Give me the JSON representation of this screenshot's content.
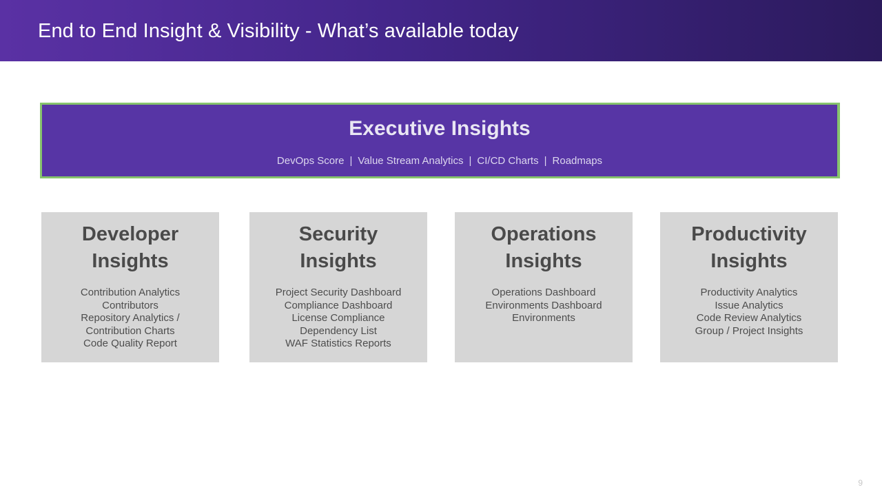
{
  "header": {
    "title": "End to End Insight & Visibility - What’s available today"
  },
  "executive": {
    "title": "Executive Insights",
    "items": [
      "DevOps Score",
      "Value Stream Analytics",
      "CI/CD Charts",
      "Roadmaps"
    ],
    "separator": "|"
  },
  "cards": [
    {
      "title_line1": "Developer",
      "title_line2": "Insights",
      "items": [
        "Contribution Analytics",
        "Contributors",
        "Repository Analytics /",
        "Contribution Charts",
        "Code Quality Report"
      ]
    },
    {
      "title_line1": "Security",
      "title_line2": "Insights",
      "items": [
        "Project Security Dashboard",
        "Compliance Dashboard",
        "License Compliance",
        "Dependency List",
        "WAF Statistics Reports"
      ]
    },
    {
      "title_line1": "Operations",
      "title_line2": "Insights",
      "items": [
        "Operations Dashboard",
        "Environments Dashboard",
        "Environments"
      ]
    },
    {
      "title_line1": "Productivity",
      "title_line2": "Insights",
      "items": [
        "Productivity Analytics",
        "Issue Analytics",
        "Code Review Analytics",
        "Group / Project Insights"
      ]
    }
  ],
  "footer": {
    "page_number": "9"
  },
  "colors": {
    "header_start": "#5a31a4",
    "header_end": "#2b1a5c",
    "executive_fill": "#5735a5",
    "executive_border": "#86c36c",
    "card_fill": "#d6d6d6"
  }
}
